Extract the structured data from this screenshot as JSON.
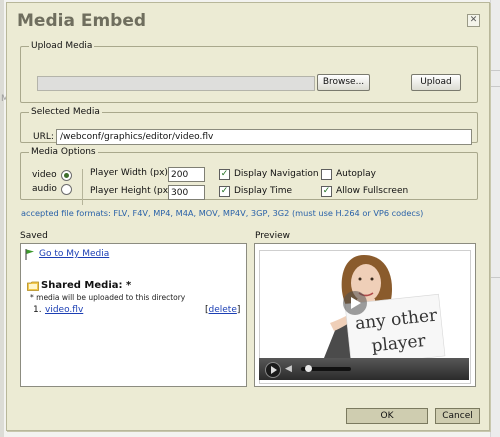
{
  "background": {
    "left_mark": "M"
  },
  "dialog": {
    "title": "Media Embed",
    "close_glyph": "✕"
  },
  "upload_media": {
    "legend": "Upload Media",
    "browse_label": "Browse...",
    "upload_label": "Upload"
  },
  "selected_media": {
    "legend": "Selected Media",
    "url_label": "URL:",
    "url_value": "/webconf/graphics/editor/video.flv"
  },
  "media_options": {
    "legend": "Media Options",
    "types": [
      {
        "label": "video",
        "selected": true
      },
      {
        "label": "audio",
        "selected": false
      }
    ],
    "player_width_label": "Player Width (px)",
    "player_width_value": "200",
    "player_height_label": "Player Height (px)",
    "player_height_value": "300",
    "checkboxes": [
      {
        "label": "Display Navigation",
        "checked": true
      },
      {
        "label": "Display Time",
        "checked": true
      },
      {
        "label": "Autoplay",
        "checked": false
      },
      {
        "label": "Allow Fullscreen",
        "checked": true
      }
    ]
  },
  "accepted_formats": "accepted file formats: FLV, F4V, MP4, M4A, MOV, MP4V, 3GP, 3G2 (must use H.264 or VP6 codecs)",
  "saved": {
    "title": "Saved",
    "go_to_link": "Go to My Media",
    "shared_title": "Shared Media: *",
    "note": "* media will be uploaded to this directory",
    "items": [
      {
        "number": "1.",
        "name": "video.flv",
        "delete_label": "delete"
      }
    ]
  },
  "preview": {
    "title": "Preview",
    "sign_text_line1": "any other",
    "sign_text_line2": "player"
  },
  "footer": {
    "ok_label": "OK",
    "cancel_label": "Cancel"
  },
  "colors": {
    "dialog_bg": "#ecebd4",
    "title": "#6f6e5e",
    "link": "#1c3fb4",
    "formats_text": "#2a62a8",
    "footer_button": "#cfcdb0"
  }
}
